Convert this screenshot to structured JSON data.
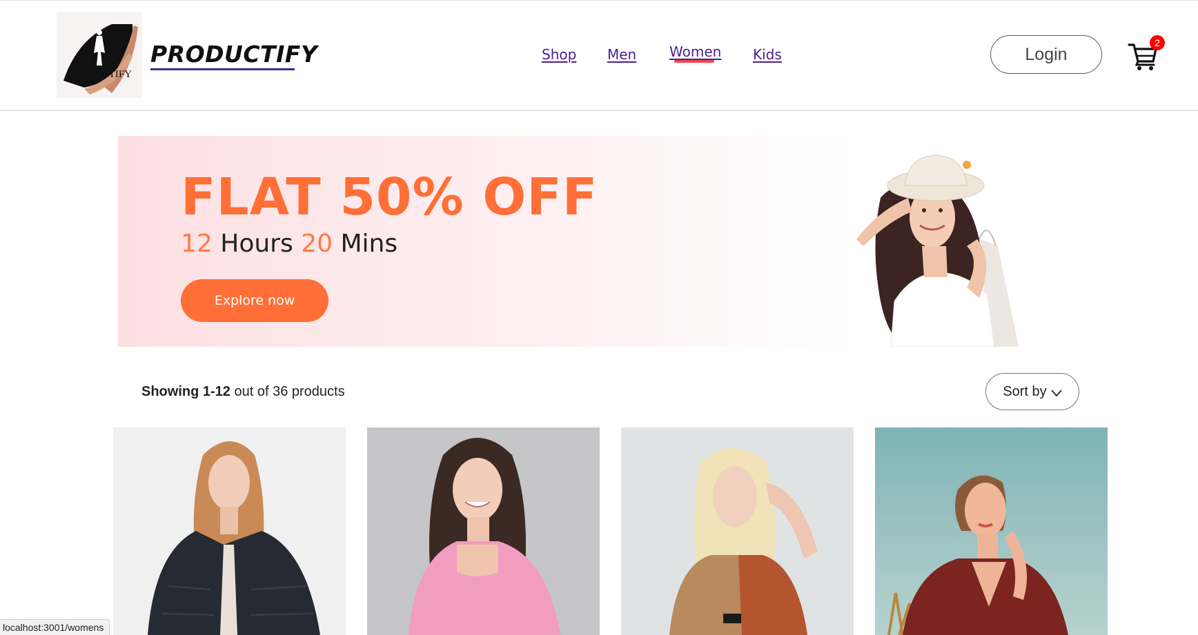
{
  "header": {
    "brand": "PRODUCTIFY",
    "logo_text": "PRODUCTIFY",
    "nav": [
      {
        "label": "Shop"
      },
      {
        "label": "Men"
      },
      {
        "label": "Women",
        "active": true
      },
      {
        "label": "Kids"
      }
    ],
    "login_label": "Login",
    "cart_count": "2"
  },
  "banner": {
    "title": "FLAT 50% OFF",
    "hours_value": "12",
    "hours_label": "Hours",
    "mins_value": "20",
    "mins_label": "Mins",
    "cta_label": "Explore now"
  },
  "listing": {
    "showing_bold": "Showing 1-12",
    "showing_rest": "out of 36 products",
    "sort_label": "Sort by"
  },
  "products": [
    {
      "image": "woman-fur-jacket"
    },
    {
      "image": "woman-pink-top"
    },
    {
      "image": "woman-blonde-top"
    },
    {
      "image": "woman-red-dress"
    }
  ],
  "status_bar": "localhost:3001/womens",
  "colors": {
    "accent": "#ff6f37",
    "nav_link": "#4b1e8f",
    "active_indicator": "#f0434f",
    "cart_badge": "#ff0000"
  }
}
